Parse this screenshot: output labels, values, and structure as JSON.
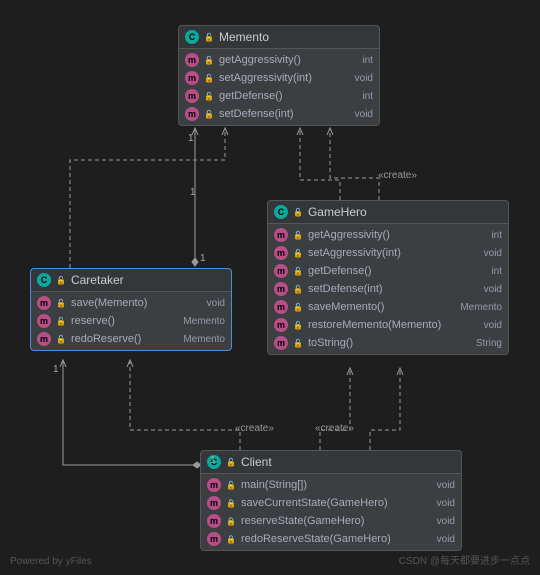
{
  "classes": {
    "memento": {
      "name": "Memento",
      "methods": [
        {
          "name": "getAggressivity()",
          "ret": "int",
          "vis": "pub"
        },
        {
          "name": "setAggressivity(int)",
          "ret": "void",
          "vis": "pub"
        },
        {
          "name": "getDefense()",
          "ret": "int",
          "vis": "pub"
        },
        {
          "name": "setDefense(int)",
          "ret": "void",
          "vis": "pub"
        }
      ]
    },
    "caretaker": {
      "name": "Caretaker",
      "methods": [
        {
          "name": "save(Memento)",
          "ret": "void",
          "vis": "pub"
        },
        {
          "name": "reserve()",
          "ret": "Memento",
          "vis": "pub"
        },
        {
          "name": "redoReserve()",
          "ret": "Memento",
          "vis": "pub"
        }
      ]
    },
    "gamehero": {
      "name": "GameHero",
      "methods": [
        {
          "name": "getAggressivity()",
          "ret": "int",
          "vis": "pub"
        },
        {
          "name": "setAggressivity(int)",
          "ret": "void",
          "vis": "pub"
        },
        {
          "name": "getDefense()",
          "ret": "int",
          "vis": "pub"
        },
        {
          "name": "setDefense(int)",
          "ret": "void",
          "vis": "pub"
        },
        {
          "name": "saveMemento()",
          "ret": "Memento",
          "vis": "pub"
        },
        {
          "name": "restoreMemento(Memento)",
          "ret": "void",
          "vis": "pub"
        },
        {
          "name": "toString()",
          "ret": "String",
          "vis": "pub"
        }
      ]
    },
    "client": {
      "name": "Client",
      "methods": [
        {
          "name": "main(String[])",
          "ret": "void",
          "vis": "pub"
        },
        {
          "name": "saveCurrentState(GameHero)",
          "ret": "void",
          "vis": "priv"
        },
        {
          "name": "reserveState(GameHero)",
          "ret": "void",
          "vis": "priv"
        },
        {
          "name": "redoReserveState(GameHero)",
          "ret": "void",
          "vis": "priv"
        }
      ]
    }
  },
  "stereo": {
    "create": "«create»"
  },
  "mult": {
    "one": "1"
  },
  "wm": {
    "left": "Powered by yFiles",
    "right": "CSDN @每天都要进步一点点"
  }
}
